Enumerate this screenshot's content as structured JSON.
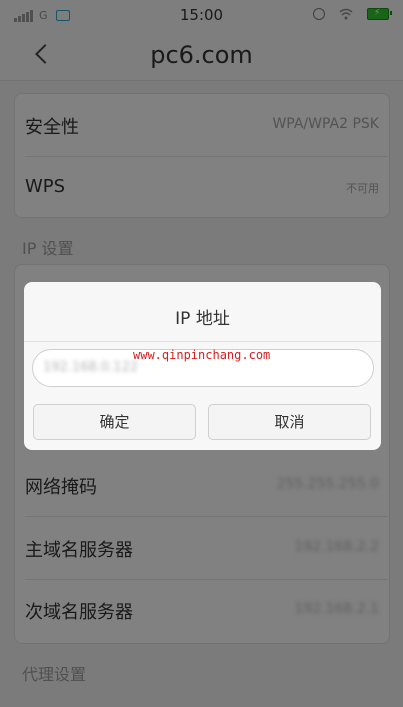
{
  "status_bar": {
    "network": "G",
    "time": "15:00",
    "battery": "⚡"
  },
  "header": {
    "title": "pc6.com"
  },
  "security_card": {
    "rows": [
      {
        "label": "安全性",
        "value": "WPA/WPA2 PSK"
      },
      {
        "label": "WPS",
        "value": "不可用"
      }
    ]
  },
  "ip_settings": {
    "section_label": "IP 设置",
    "rows": [
      {
        "label": "网络掩码",
        "value": "255.255.255.0"
      },
      {
        "label": "主域名服务器",
        "value": "192.168.2.2"
      },
      {
        "label": "次域名服务器",
        "value": "192.168.2.1"
      }
    ]
  },
  "proxy_section": {
    "label": "代理设置"
  },
  "dialog": {
    "title": "IP 地址",
    "input_value": "192.168.0.122",
    "watermark": "www.qinpinchang.com",
    "confirm_label": "确定",
    "cancel_label": "取消"
  }
}
